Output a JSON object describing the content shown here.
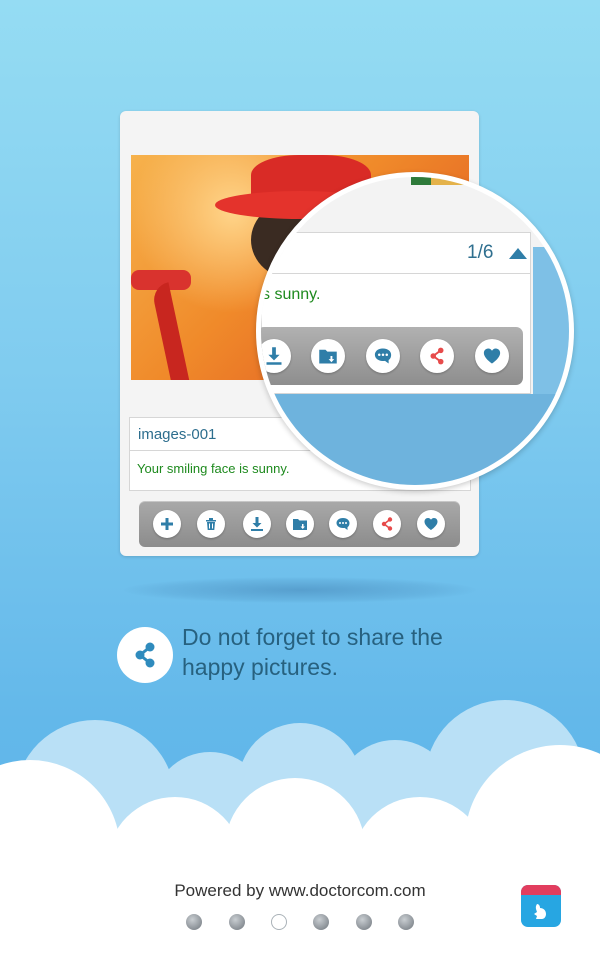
{
  "card": {
    "image_title": "images-001",
    "caption": "Your smiling face is sunny."
  },
  "toolbar": {
    "buttons": [
      "add-icon",
      "delete-icon",
      "download-icon",
      "save-to-folder-icon",
      "comment-icon",
      "share-icon",
      "favorite-icon"
    ]
  },
  "magnifier": {
    "page_indicator": "1/6",
    "caption_fragment": "s sunny.",
    "buttons": [
      "download-icon",
      "save-to-folder-icon",
      "comment-icon",
      "share-icon",
      "favorite-icon"
    ]
  },
  "tip": {
    "text_line1": "Do not forget to share the",
    "text_line2": "happy pictures."
  },
  "footer": {
    "powered_by": "Powered by www.doctorcom.com",
    "page_dots_total": 6,
    "page_dots_active": 3
  },
  "colors": {
    "accent_teal": "#2f7ea8",
    "share_red": "#e74b4b",
    "caption_green": "#1e8a1e"
  }
}
